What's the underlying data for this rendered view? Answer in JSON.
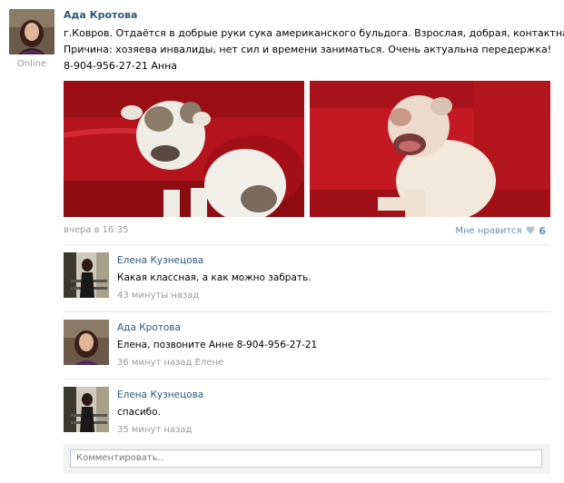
{
  "post": {
    "author": "Ада Кротова",
    "status": "Online",
    "text_lines": [
      "г.Ковров. Отдаётся в добрые руки сука американского бульдога. Взрослая, добрая, контактная.",
      "Причина: хозяева инвалиды, нет сил и времени заниматься. Очень актуальна передержка!",
      "8-904-956-27-21 Анна"
    ],
    "timestamp": "вчера в 16:35",
    "like_label": "Мне нравится",
    "like_count": "6",
    "photos": [
      "dog-photo-1",
      "dog-photo-2"
    ]
  },
  "comments": [
    {
      "author": "Елена Кузнецова",
      "text": "Какая классная, а как можно забрать.",
      "time": "43 минуты назад",
      "reply_to": ""
    },
    {
      "author": "Ада Кротова",
      "text": "Елена, позвоните Анне 8-904-956-27-21",
      "time": "36 минут назад",
      "reply_to": "Елене"
    },
    {
      "author": "Елена Кузнецова",
      "text": "спасибо.",
      "time": "35 минут назад",
      "reply_to": ""
    }
  ],
  "comment_input": {
    "placeholder": "Комментировать.."
  },
  "colors": {
    "link": "#2b587a",
    "meta": "#999999",
    "sofa_red": "#c41a22",
    "heart": "#a8bed3"
  }
}
